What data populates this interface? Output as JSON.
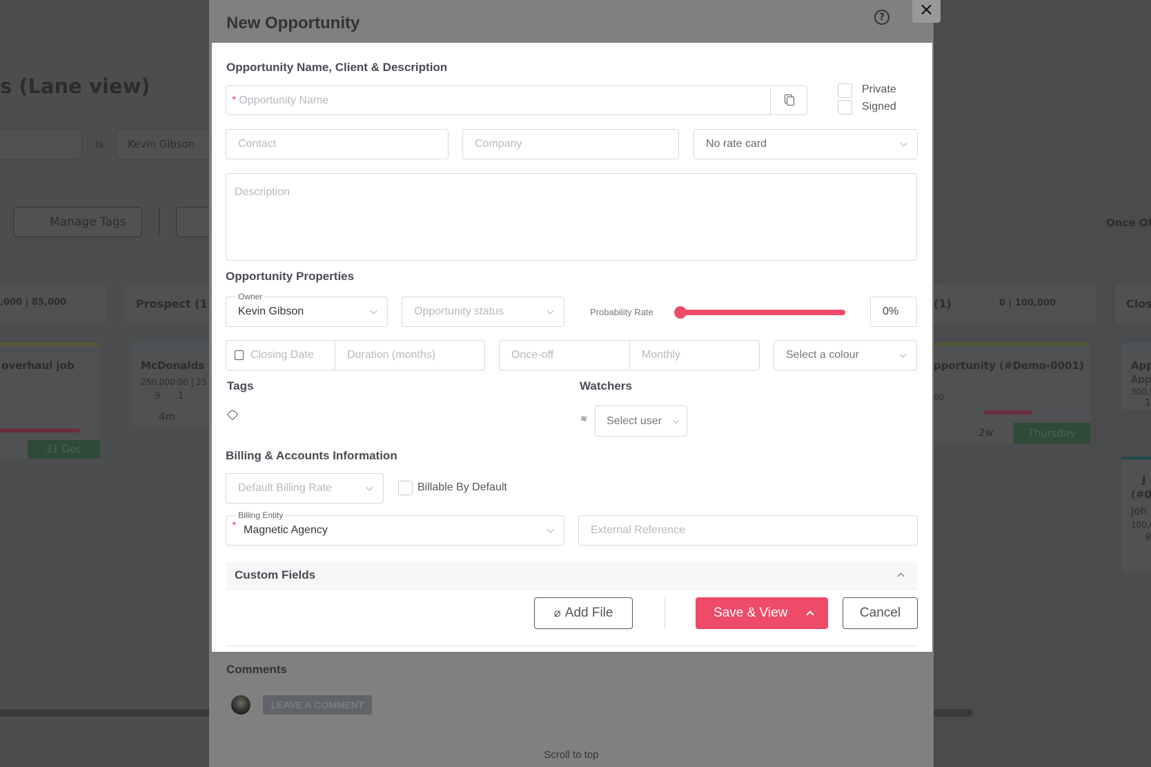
{
  "background": {
    "page_title": "s (Lane view)",
    "filter_operator": "is",
    "filter_value": "Kevin Gibson",
    "manage_tags_label": "Manage Tags",
    "right_header_label": "Once Of",
    "lanes": [
      {
        "header": ",000 | 85,000",
        "card_title": "overhaul job",
        "card_date": "31 Dec"
      },
      {
        "header": "Prospect (1)",
        "card_title": "McDonalds F",
        "card_amount": "250,000.00  |  25",
        "card_counts": [
          "9",
          "1"
        ],
        "card_age": "4m"
      },
      {
        "header": "(1)",
        "header_amount": "0 | 100,000",
        "card_title": "pportunity (#Demo-0001)",
        "card_amount": "00",
        "card_age": "2w",
        "card_date": "Thursday"
      },
      {
        "header": "Closi",
        "card_title": "App",
        "card_sub": "App",
        "card_amount": "300,0",
        "card_count": "1",
        "card2_title": "J",
        "card2_ref": "(#0",
        "card2_sub": "Joh",
        "card2_amount": "100,0",
        "card2_count": "9"
      }
    ]
  },
  "modal": {
    "title": "New Opportunity",
    "close_label": "×",
    "section_name": "Opportunity Name, Client & Description",
    "opportunity_name_placeholder": "Opportunity Name",
    "required_mark": "*",
    "private_label": "Private",
    "signed_label": "Signed",
    "contact_placeholder": "Contact",
    "company_placeholder": "Company",
    "rate_card_value": "No rate card",
    "description_placeholder": "Description",
    "section_properties": "Opportunity Properties",
    "owner_label": "Owner",
    "owner_value": "Kevin Gibson",
    "status_placeholder": "Opportunity status",
    "probability_label": "Probability Rate",
    "probability_value": "0%",
    "probability_percent": 0,
    "closing_date_placeholder": "Closing Date",
    "duration_placeholder": "Duration (months)",
    "once_off_placeholder": "Once-off",
    "monthly_placeholder": "Monthly",
    "colour_placeholder": "Select a colour",
    "tags_title": "Tags",
    "watchers_title": "Watchers",
    "select_user_placeholder": "Select user",
    "section_billing": "Billing & Accounts Information",
    "billing_rate_placeholder": "Default Billing Rate",
    "billable_label": "Billable By Default",
    "billing_entity_label": "Billing Entity",
    "billing_entity_value": "Magnetic Agency",
    "external_reference_placeholder": "External Reference",
    "custom_fields_title": "Custom Fields",
    "add_file_label": "Add File",
    "save_view_label": "Save & View",
    "cancel_label": "Cancel",
    "comments_title": "Comments",
    "leave_comment_label": "LEAVE A COMMENT",
    "scroll_top_label": "Scroll to top",
    "accent_color": "#ee4b68"
  }
}
